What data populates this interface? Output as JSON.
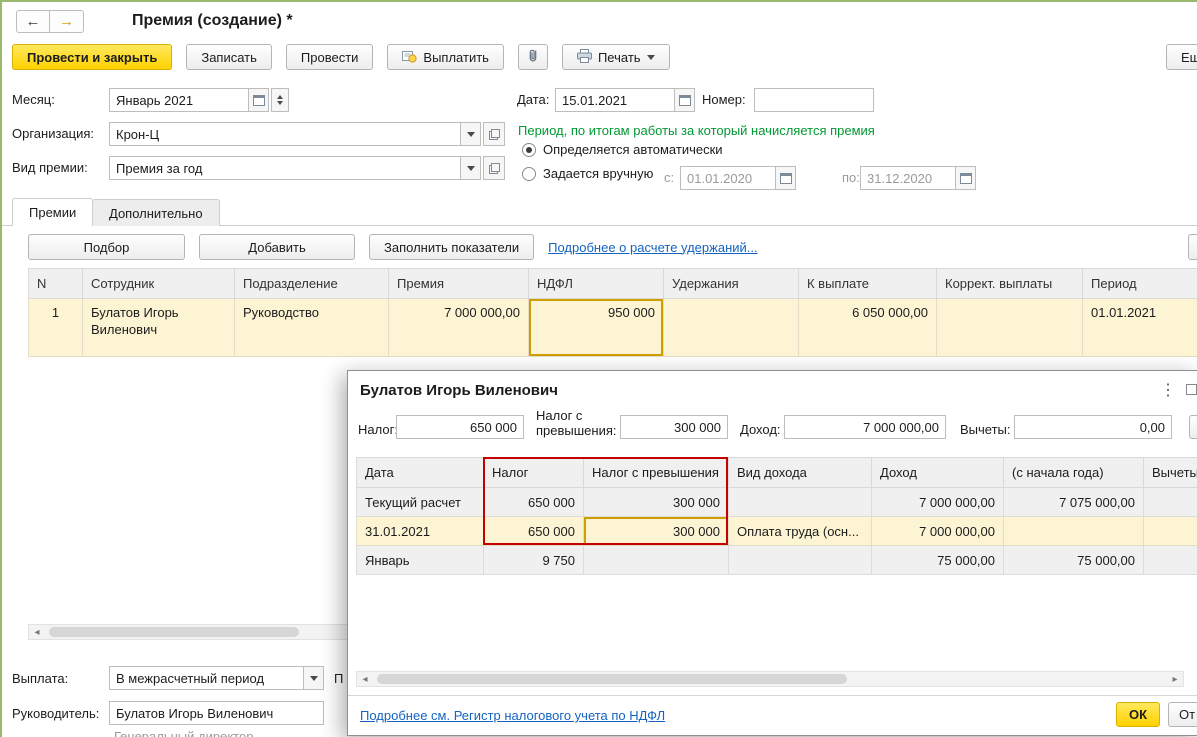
{
  "colors": {
    "accent_yellow": "#ffd200",
    "selected_row": "#fcf4d3",
    "focused_cell": "#fadc7d",
    "focused_cell_border": "#cf9e00",
    "hint_green": "#009933",
    "link_blue": "#1464c0",
    "highlight_red": "#c40000",
    "window_frame_green": "#9ab86e"
  },
  "icons": {
    "back_arrow": "←",
    "forward_arrow": "→",
    "more_vertical": "⋮",
    "scroll_left": "◂",
    "scroll_right": "▸"
  },
  "window": {
    "title": "Премия (создание) *"
  },
  "toolbar": {
    "post_and_close": "Провести и закрыть",
    "write": "Записать",
    "post": "Провести",
    "pay": "Выплатить",
    "print": "Печать",
    "more_cut": "Ещ"
  },
  "form": {
    "month_label": "Месяц:",
    "month_value": "Январь 2021",
    "date_label": "Дата:",
    "date_value": "15.01.2021",
    "number_label": "Номер:",
    "number_value": "",
    "org_label": "Организация:",
    "org_value": "Крон-Ц",
    "bonus_type_label": "Вид премии:",
    "bonus_type_value": "Премия за год",
    "period_hint": "Период, по итогам работы за который начисляется премия",
    "auto_option": "Определяется автоматически",
    "manual_option": "Задается вручную",
    "from_label": "с:",
    "from_value": "01.01.2020",
    "to_label": "по:",
    "to_value": "31.12.2020"
  },
  "tabs": {
    "bonuses": "Премии",
    "additional": "Дополнительно"
  },
  "command_bar": {
    "pick": "Подбор",
    "add": "Добавить",
    "fill": "Заполнить показатели",
    "deductions_link": "Подробнее о расчете удержаний..."
  },
  "grid": {
    "headers": [
      "N",
      "Сотрудник",
      "Подразделение",
      "Премия",
      "НДФЛ",
      "Удержания",
      "К выплате",
      "Коррект. выплаты",
      "Период"
    ],
    "rows": [
      {
        "n": "1",
        "employee": "Булатов Игорь Виленович",
        "department": "Руководство",
        "bonus": "7 000 000,00",
        "ndfl": "950 000",
        "deductions": "",
        "to_pay": "6 050 000,00",
        "adjustment": "",
        "period": "01.01.2021"
      }
    ]
  },
  "footer_form": {
    "payment_label": "Выплата:",
    "payment_value": "В межрасчетный период",
    "next_label_cut": "П",
    "manager_label": "Руководитель:",
    "manager_value": "Булатов Игорь Виленович",
    "manager_position": "Генеральный директор"
  },
  "modal": {
    "title": "Булатов Игорь Виленович",
    "tax_label": "Налог:",
    "tax_value": "650 000",
    "excess_label": "Налог с превышения:",
    "excess_value": "300 000",
    "income_label": "Доход:",
    "income_value": "7 000 000,00",
    "deduction_label": "Вычеты:",
    "deduction_value": "0,00",
    "table": {
      "headers": [
        "Дата",
        "Налог",
        "Налог с превышения",
        "Вид дохода",
        "Доход",
        "(с начала года)",
        "Вычеты"
      ],
      "rows": [
        {
          "date": "Текущий расчет",
          "tax": "650 000",
          "excess": "300 000",
          "income_type": "",
          "income": "7 000 000,00",
          "ytd": "7 075 000,00",
          "deductions": ""
        },
        {
          "date": "31.01.2021",
          "tax": "650 000",
          "excess": "300 000",
          "income_type": "Оплата труда (осн...",
          "income": "7 000 000,00",
          "ytd": "",
          "deductions": ""
        },
        {
          "date": "Январь",
          "tax": "9 750",
          "excess": "",
          "income_type": "",
          "income": "75 000,00",
          "ytd": "75 000,00",
          "deductions": ""
        }
      ]
    },
    "register_link": "Подробнее см. Регистр налогового учета по НДФЛ",
    "ok": "ОК",
    "cancel_cut": "От"
  }
}
